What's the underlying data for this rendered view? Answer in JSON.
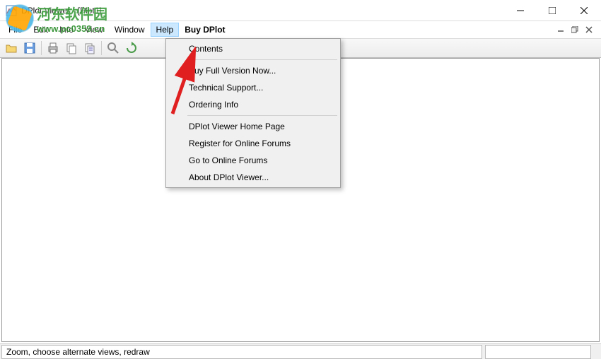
{
  "window": {
    "title": "DPlot Viewer - [Plot1]"
  },
  "menu": {
    "file": "File",
    "edit": "Edit",
    "info": "Info",
    "view": "View",
    "window": "Window",
    "help": "Help",
    "buy": "Buy DPlot"
  },
  "help_menu": {
    "contents": "Contents",
    "buy_full": "Buy Full Version Now...",
    "tech_support": "Technical Support...",
    "ordering": "Ordering Info",
    "home_page": "DPlot Viewer Home Page",
    "register_forums": "Register for Online Forums",
    "goto_forums": "Go to Online Forums",
    "about": "About DPlot Viewer..."
  },
  "status": {
    "text": "Zoom, choose alternate views, redraw"
  },
  "watermark": {
    "cn": "河东软件园",
    "url": "www.pc0359.cn"
  },
  "icons": {
    "app": "app-icon",
    "minimize": "minimize-icon",
    "maximize": "maximize-icon",
    "close": "close-icon"
  }
}
